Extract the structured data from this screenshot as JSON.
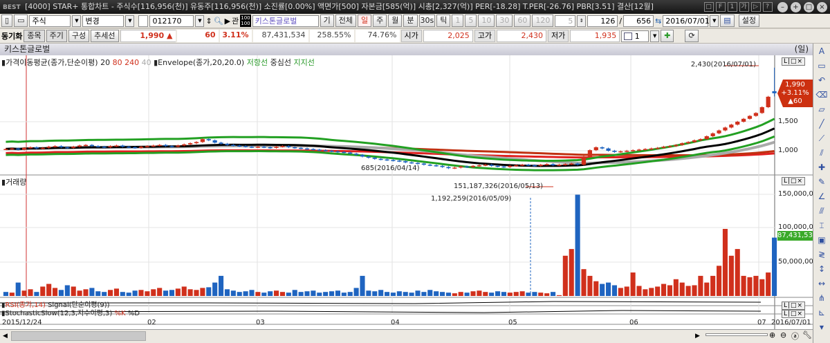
{
  "window": {
    "logo": "BEST",
    "title": "[4000] STAR+ 통합차트 - 주식수[116,956(천)] 유동주[116,956(천)] 소진률[0.00%] 액면가[500] 자본금[585(억)] 시총[2,327(억)] PER[-18.28] T.PER[-26.76] PBR[3.51] 결산[12월]",
    "buttons": [
      "□",
      "F",
      "1",
      "가",
      "▷",
      "?"
    ]
  },
  "toolbar": {
    "market": "주식",
    "change": "변경",
    "code": "012170",
    "related": "관",
    "name": "키스톤글로벌",
    "gi": "기",
    "all": "전체",
    "periods": [
      "일",
      "주",
      "월",
      "분",
      "30s",
      "틱"
    ],
    "active_period": "일",
    "intervals": [
      "1",
      "5",
      "10",
      "30",
      "60",
      "120"
    ],
    "count_step": "5",
    "count": "126",
    "total": "656",
    "date": "2016/07/01",
    "settings": "설정"
  },
  "row2": {
    "sync": "동기화",
    "buttons": [
      "종목",
      "주기",
      "구성",
      "추세선"
    ],
    "price": "1,990 ▲",
    "change": "60",
    "change_pct": "3.11%",
    "volume": "87,431,534",
    "vol_ratio": "258.55%",
    "turnover": "74.76%",
    "open_label": "시가",
    "open": "2,025",
    "high_label": "고가",
    "high": "2,430",
    "low_label": "저가",
    "low": "1,935",
    "layout_num": "1"
  },
  "chart_title": {
    "name": "키스톤글로벌",
    "unit": "(일)"
  },
  "legends": {
    "ma": "가격이동평균(종가,단순이평)",
    "ma_periods": [
      "20",
      "80",
      "240",
      "40"
    ],
    "env": "Envelope(종가,20,20.0)",
    "env_upper": "저항선",
    "env_mid": "중심선",
    "env_lower": "지지선",
    "volume": "거래량",
    "rsi": "RSI(종가,14)",
    "rsi_signal": "Signal(단순이평(9))",
    "stoch": "StochasticSlow(12,3,지수이평,3)",
    "stoch_k": "%K",
    "stoch_d": "%D"
  },
  "annotations": {
    "high": "2,430(2016/07/01)",
    "low": "685(2016/04/14)",
    "vol_max": "151,187,326(2016/05/13)",
    "vol_min": "1,192,259(2016/05/09)"
  },
  "price_badge": {
    "price": "1,990",
    "pct": "+3.11%",
    "chg": "▲60"
  },
  "volume_badge": "87,431,534",
  "price_axis": [
    "1,500",
    "1,000"
  ],
  "volume_axis": [
    "150,000,000",
    "100,000,000",
    "50,000,000"
  ],
  "date_axis": [
    "2015/12/24",
    "02",
    "03",
    "04",
    "05",
    "06",
    "07",
    "2016/07/01"
  ],
  "colors": {
    "up": "#d0301c",
    "down": "#1f64c0",
    "ma20": "#000000",
    "ma80": "#c03010",
    "ma240": "#aaaaaa",
    "envelope": "#22a022"
  },
  "chart_data": {
    "type": "candlestick",
    "bars": 126,
    "close": [
      1030,
      1040,
      1020,
      1050,
      1060,
      1040,
      1050,
      1070,
      1080,
      1060,
      1050,
      1070,
      1090,
      1100,
      1080,
      1070,
      1060,
      1080,
      1090,
      1070,
      1060,
      1050,
      1070,
      1080,
      1090,
      1100,
      1080,
      1070,
      1090,
      1110,
      1130,
      1150,
      1200,
      1180,
      1140,
      1120,
      1100,
      1090,
      1080,
      1070,
      1060,
      1070,
      1060,
      1050,
      1070,
      1080,
      1060,
      1050,
      1040,
      1030,
      1020,
      1010,
      1000,
      990,
      980,
      970,
      950,
      930,
      900,
      880,
      860,
      850,
      840,
      830,
      820,
      800,
      790,
      780,
      760,
      750,
      740,
      720,
      700,
      710,
      730,
      720,
      740,
      750,
      760,
      740,
      730,
      720,
      740,
      750,
      760,
      750,
      740,
      760,
      770,
      750,
      760,
      770,
      780,
      760,
      900,
      1010,
      1060,
      1040,
      1000,
      980,
      990,
      1000,
      1010,
      1020,
      1030,
      1040,
      1050,
      1070,
      1080,
      1100,
      1130,
      1150,
      1180,
      1200,
      1250,
      1300,
      1350,
      1400,
      1450,
      1500,
      1550,
      1600,
      1650,
      1750,
      1930,
      1990
    ],
    "volume_m": [
      6,
      5,
      20,
      8,
      10,
      6,
      14,
      18,
      12,
      9,
      16,
      14,
      8,
      10,
      12,
      7,
      6,
      9,
      11,
      6,
      5,
      8,
      9,
      7,
      10,
      12,
      8,
      9,
      11,
      14,
      10,
      9,
      12,
      13,
      20,
      30,
      10,
      8,
      6,
      7,
      9,
      6,
      5,
      7,
      8,
      6,
      5,
      9,
      6,
      7,
      8,
      5,
      6,
      7,
      8,
      5,
      6,
      12,
      30,
      8,
      7,
      9,
      6,
      5,
      7,
      6,
      5,
      8,
      6,
      9,
      7,
      6,
      5,
      4,
      6,
      5,
      7,
      8,
      6,
      5,
      7,
      6,
      5,
      6,
      7,
      5,
      6,
      5,
      4,
      6,
      1.2,
      60,
      70,
      151,
      40,
      30,
      22,
      18,
      20,
      16,
      12,
      14,
      35,
      15,
      10,
      12,
      14,
      18,
      16,
      25,
      20,
      15,
      16,
      30,
      20,
      30,
      45,
      100,
      60,
      70,
      30,
      28,
      30,
      25,
      35,
      87
    ],
    "last_bar": {
      "open": 2025,
      "high": 2430,
      "low": 1935,
      "close": 1990
    },
    "price_ylim": [
      500,
      2500
    ],
    "volume_ylim": [
      0,
      160000000
    ]
  }
}
